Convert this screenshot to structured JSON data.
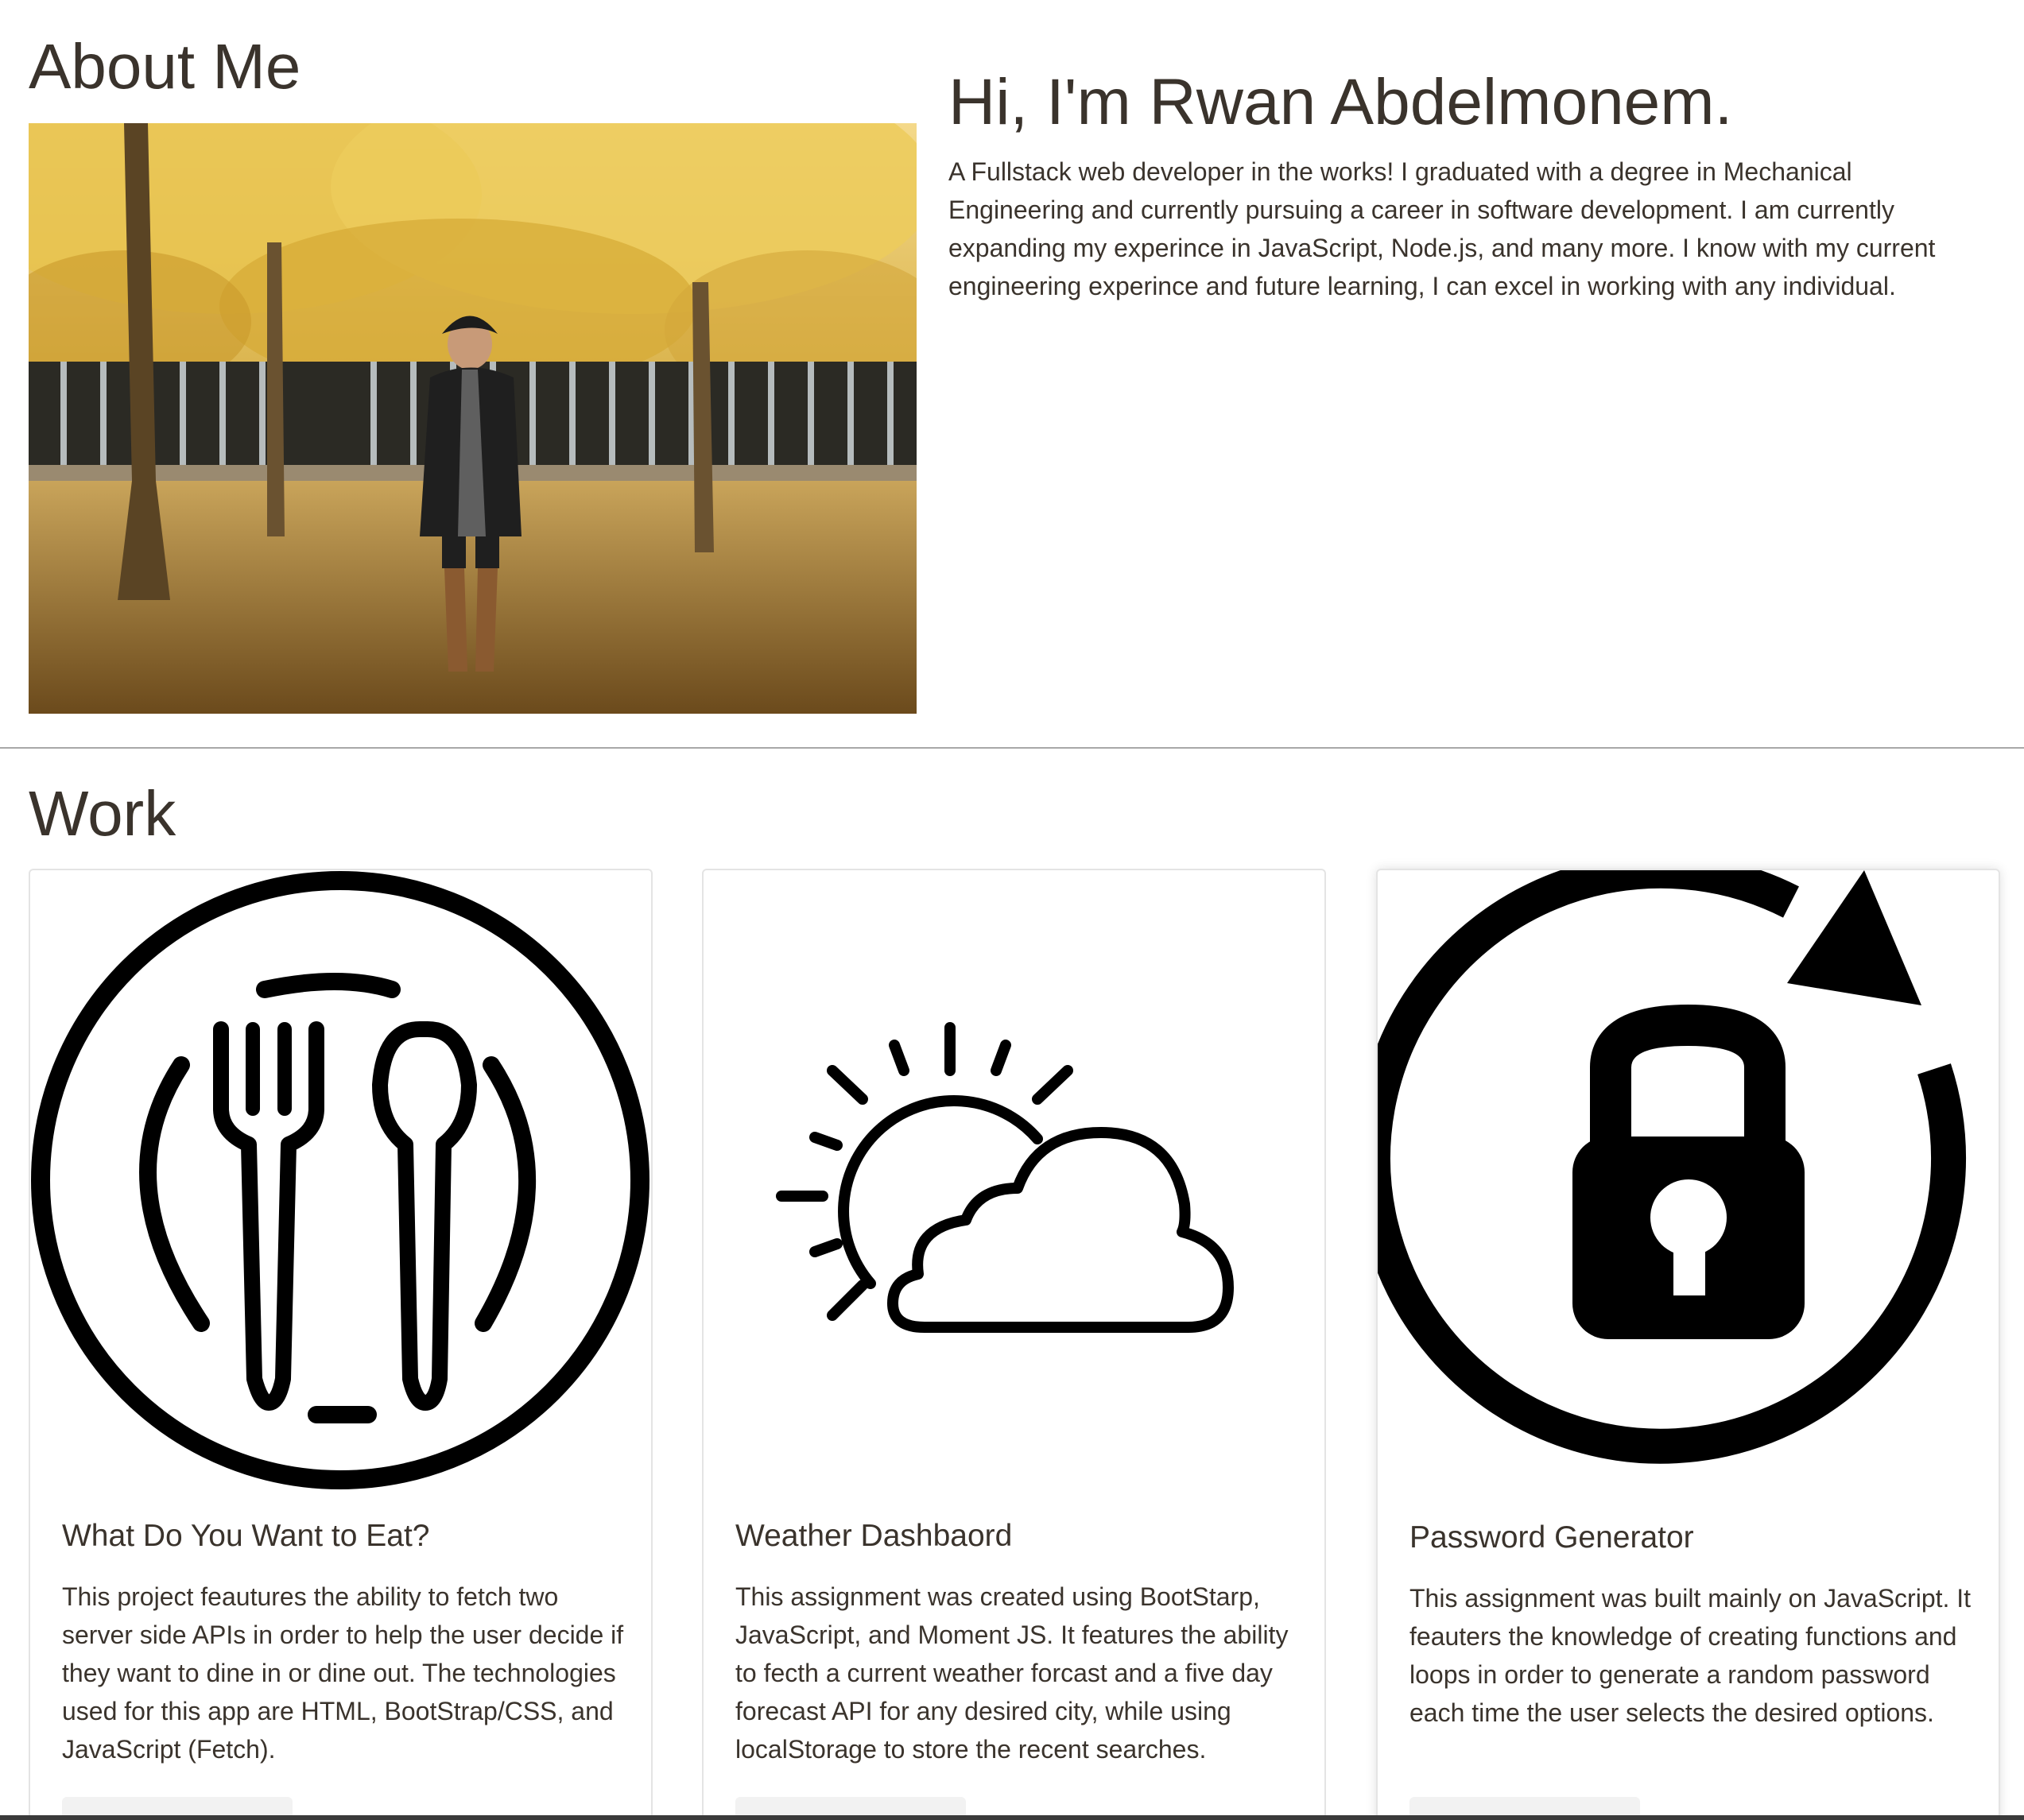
{
  "about": {
    "heading": "About Me",
    "greeting": "Hi, I'm Rwan Abdelmonem.",
    "bio": "A Fullstack web developer in the works! I graduated with a degree in Mechanical Engineering and currently pursuing a career in software development. I am currently expanding my experince in JavaScript, Node.js, and many more. I know with my current engineering experince and future learning, I can excel in working with any individual."
  },
  "work": {
    "heading": "Work",
    "projects": [
      {
        "icon": "fork-spoon-plate-icon",
        "title": "What Do You Want to Eat?",
        "description": "This project feautures the ability to fetch two server side APIs in order to help the user decide if they want to dine in or dine out. The technologies used for this app are HTML, BootStrap/CSS, and JavaScript (Fetch)."
      },
      {
        "icon": "sun-cloud-icon",
        "title": "Weather Dashbaord",
        "description": "This assignment was created using BootStarp, JavaScript, and Moment JS. It features the ability to fecth a current weather forcast and a five day forecast API for any desired city, while using localStorage to store the recent searches."
      },
      {
        "icon": "lock-refresh-icon",
        "title": "Password Generator",
        "description": "This assignment was built mainly on JavaScript. It feauters the knowledge of creating functions and loops in order to generate a random password each time the user selects the desired options."
      }
    ]
  },
  "colors": {
    "text": "#3a332c",
    "divider": "#a8a8a8",
    "card_border": "#e4e4e4"
  }
}
